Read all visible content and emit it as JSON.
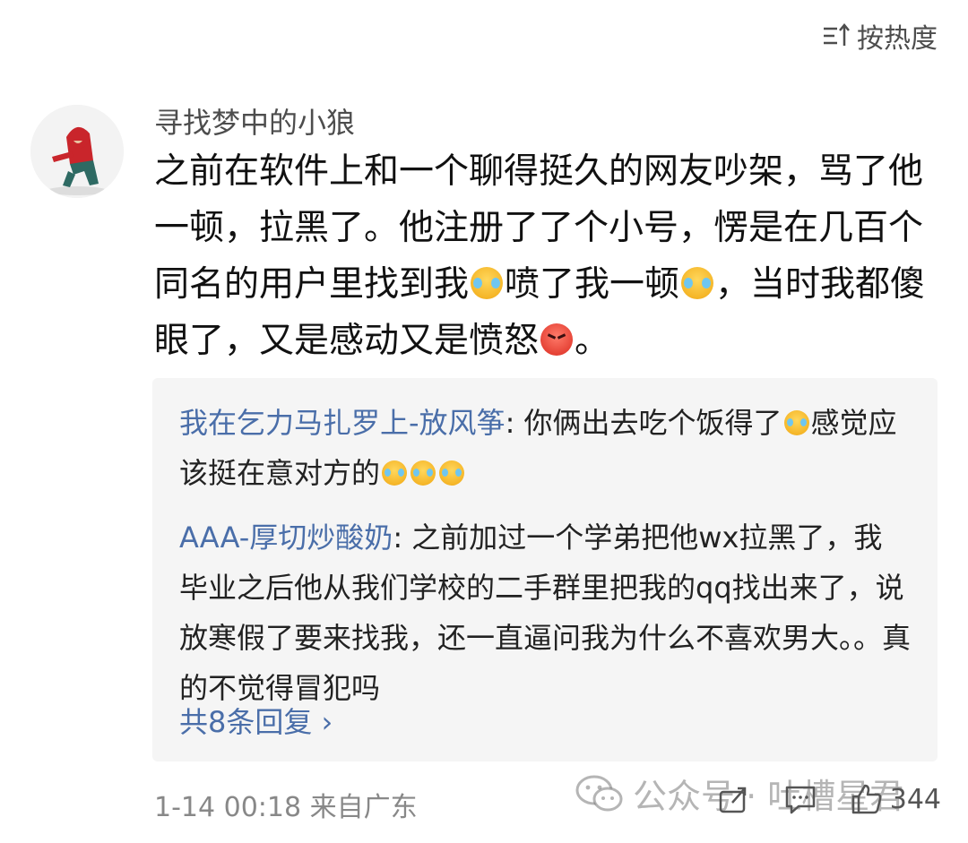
{
  "sort": {
    "label": "按热度",
    "icon": "sort-icon"
  },
  "comment": {
    "username": "寻找梦中的小狼",
    "text_segments": [
      "之前在软件上和一个聊得挺久的网友吵架，骂了他一顿，拉黑了。他注册了了个小号，愣是在几百个同名的用户里找到我",
      "喷了我一顿",
      "，当时我都傻眼了，又是感动又是愤怒",
      "。"
    ],
    "time": "1-14 00:18",
    "location": "来自广东"
  },
  "replies": [
    {
      "author": "我在乞力马扎罗上-放风筝",
      "segments": [
        "你俩出去吃个饭得了",
        "感觉应该挺在意对方的"
      ]
    },
    {
      "author": "AAA-厚切炒酸奶",
      "segments": [
        "之前加过一个学弟把他wx拉黑了，我毕业之后他从我们学校的二手群里把我的qq找出来了，说放寒假了要来找我，还一直逼问我为什么不喜欢男大。。真的不觉得冒犯吗"
      ]
    }
  ],
  "more_replies": {
    "label": "共8条回复",
    "chevron": "›"
  },
  "actions": {
    "share_icon": "share-icon",
    "comment_icon": "comment-icon",
    "like_icon": "like-icon",
    "like_count": "344"
  },
  "watermark": {
    "text": "公众号 · 吐槽星君",
    "icon": "wechat-icon"
  },
  "colors": {
    "link": "#4a6ea9",
    "reply_bg": "#f5f5f5",
    "meta": "#888888"
  }
}
